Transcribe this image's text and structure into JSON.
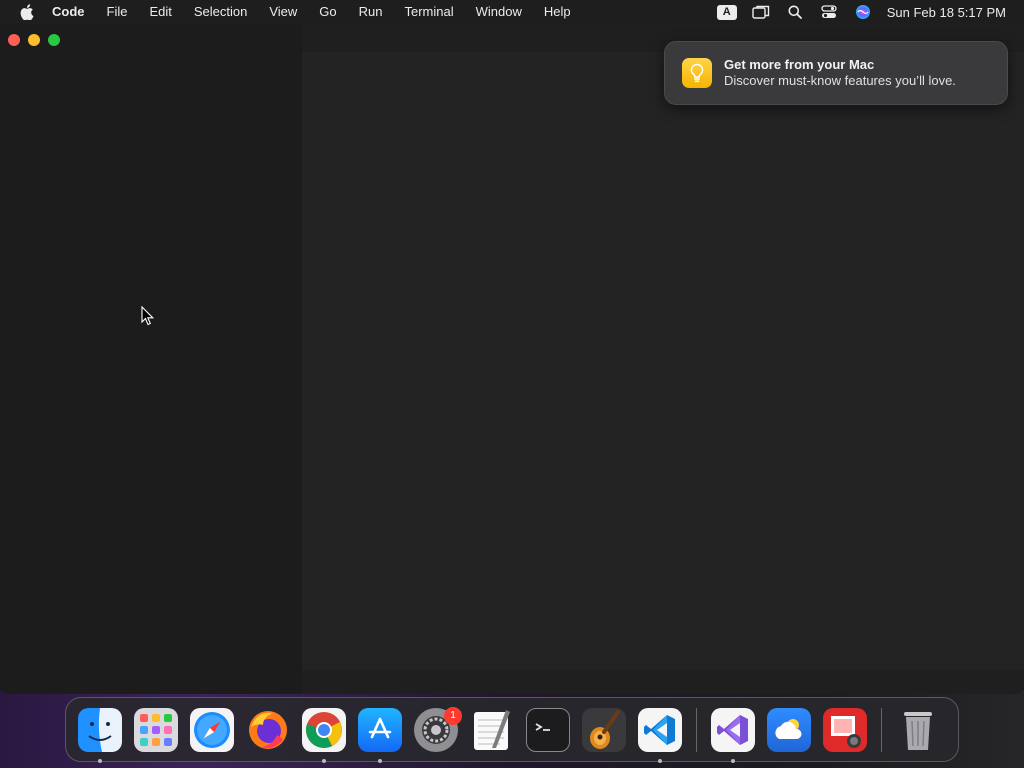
{
  "menubar": {
    "app_name": "Code",
    "items": [
      "File",
      "Edit",
      "Selection",
      "View",
      "Go",
      "Run",
      "Terminal",
      "Window",
      "Help"
    ],
    "input_source": "A",
    "clock": "Sun Feb 18  5:17 PM",
    "icons": [
      "apple-icon",
      "screen-mirroring-icon",
      "spotlight-search-icon",
      "control-center-icon",
      "siri-icon"
    ]
  },
  "notification": {
    "title": "Get more from your Mac",
    "body": "Discover must-know features you’ll love.",
    "icon": "lightbulb-icon"
  },
  "dock": {
    "apps": [
      {
        "name": "Finder",
        "icon": "finder-icon",
        "running": true
      },
      {
        "name": "Launchpad",
        "icon": "launchpad-icon",
        "running": false
      },
      {
        "name": "Safari",
        "icon": "safari-icon",
        "running": false
      },
      {
        "name": "Firefox",
        "icon": "firefox-icon",
        "running": false
      },
      {
        "name": "Google Chrome",
        "icon": "chrome-icon",
        "running": true
      },
      {
        "name": "App Store",
        "icon": "app-store-icon",
        "running": true
      },
      {
        "name": "System Settings",
        "icon": "system-settings-icon",
        "running": false,
        "badge": "1"
      },
      {
        "name": "TextEdit",
        "icon": "textedit-icon",
        "running": false
      },
      {
        "name": "Terminal",
        "icon": "terminal-icon",
        "running": false
      },
      {
        "name": "GarageBand",
        "icon": "garageband-icon",
        "running": false
      },
      {
        "name": "Visual Studio Code",
        "icon": "vscode-icon",
        "running": true
      }
    ],
    "recent_apps": [
      {
        "name": "Visual Studio",
        "icon": "visual-studio-icon",
        "running": true
      },
      {
        "name": "Weather",
        "icon": "weather-icon",
        "running": false
      },
      {
        "name": "Photo Booth",
        "icon": "photo-booth-icon",
        "running": false
      }
    ],
    "trash": {
      "name": "Trash",
      "icon": "trash-icon"
    }
  },
  "colors": {
    "menubar_bg": "#1e1e1e",
    "window_bg": "#1f1f1f",
    "editor_bg": "#232323",
    "notification_bg": "#3a3a3c"
  }
}
